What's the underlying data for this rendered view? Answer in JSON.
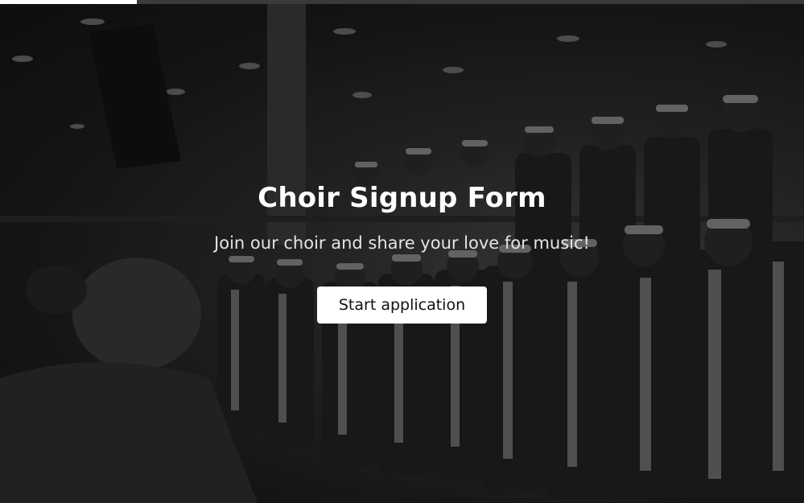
{
  "progress": {
    "fraction": 0.17,
    "fill_color": "#ffffff",
    "track_color": "#3a3a3a"
  },
  "background": {
    "image_name": "choir-photo",
    "overlay_color": "#000000"
  },
  "hero": {
    "title": "Choir Signup Form",
    "subtitle": "Join our choir and share your love for music!",
    "button_label": "Start application"
  }
}
